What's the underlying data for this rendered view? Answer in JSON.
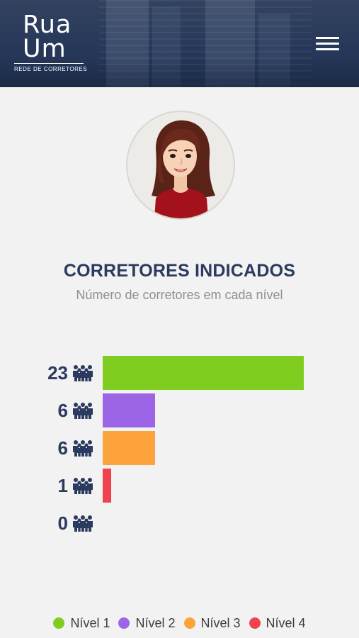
{
  "header": {
    "logo_line1": "Rua",
    "logo_line2": "Um",
    "logo_tagline": "REDE DE CORRETORES",
    "menu_icon": "hamburger-menu-icon"
  },
  "profile": {
    "avatar_icon": "woman-avatar-icon"
  },
  "section": {
    "title": "CORRETORES INDICADOS",
    "subtitle": "Número de corretores em cada nível"
  },
  "chart_data": {
    "type": "bar",
    "orientation": "horizontal",
    "categories": [
      "Nível 1",
      "Nível 2",
      "Nível 3",
      "Nível 4",
      ""
    ],
    "values": [
      23,
      6,
      6,
      1,
      0
    ],
    "colors": [
      "#7fcd1f",
      "#9b65e6",
      "#fca33c",
      "#f0424f",
      "#cccccc"
    ],
    "value_labels": [
      "23",
      "6",
      "6",
      "1",
      "0"
    ],
    "xlim": [
      0,
      23
    ],
    "grid": false,
    "legend_placement": "bottom",
    "title": "CORRETORES INDICADOS",
    "subtitle": "Número de corretores em cada nível",
    "label_icon": "group-people-icon"
  },
  "legend": [
    {
      "label": "Nível 1",
      "color": "#7fcd1f"
    },
    {
      "label": "Nível 2",
      "color": "#9b65e6"
    },
    {
      "label": "Nível 3",
      "color": "#fca33c"
    },
    {
      "label": "Nível 4",
      "color": "#f0424f"
    }
  ]
}
